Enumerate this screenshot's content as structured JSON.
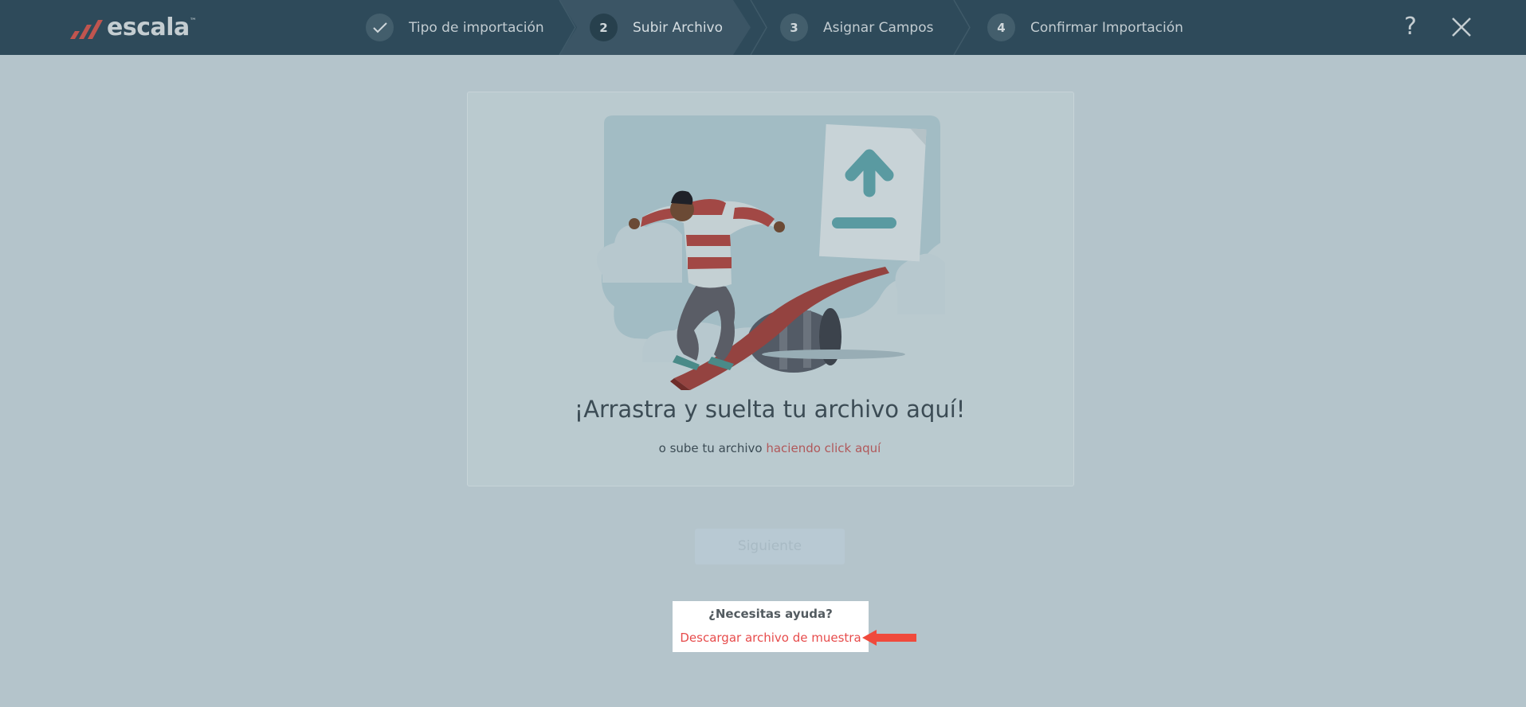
{
  "app": {
    "logo_text": "escala",
    "logo_tm": "™"
  },
  "steps": [
    {
      "number": "✓",
      "label": "Tipo de importación",
      "state": "done"
    },
    {
      "number": "2",
      "label": "Subir Archivo",
      "state": "active"
    },
    {
      "number": "3",
      "label": "Asignar Campos",
      "state": "pending"
    },
    {
      "number": "4",
      "label": "Confirmar Importación",
      "state": "pending"
    }
  ],
  "header": {
    "help_glyph": "?",
    "close_icon": "close-icon"
  },
  "upload": {
    "title": "¡Arrastra y suelta tu archivo aquí!",
    "subtitle_prefix": "o sube tu archivo",
    "subtitle_link": "haciendo click aquí"
  },
  "next_button": "Siguiente",
  "help": {
    "title": "¿Necesitas ayuda?",
    "download_link": "Descargar archivo de muestra"
  },
  "colors": {
    "topbar": "#2e4a5a",
    "overlay_background": "#b4c4cb",
    "link_red": "#e74c4c",
    "arrow_red": "#f04a3c"
  }
}
